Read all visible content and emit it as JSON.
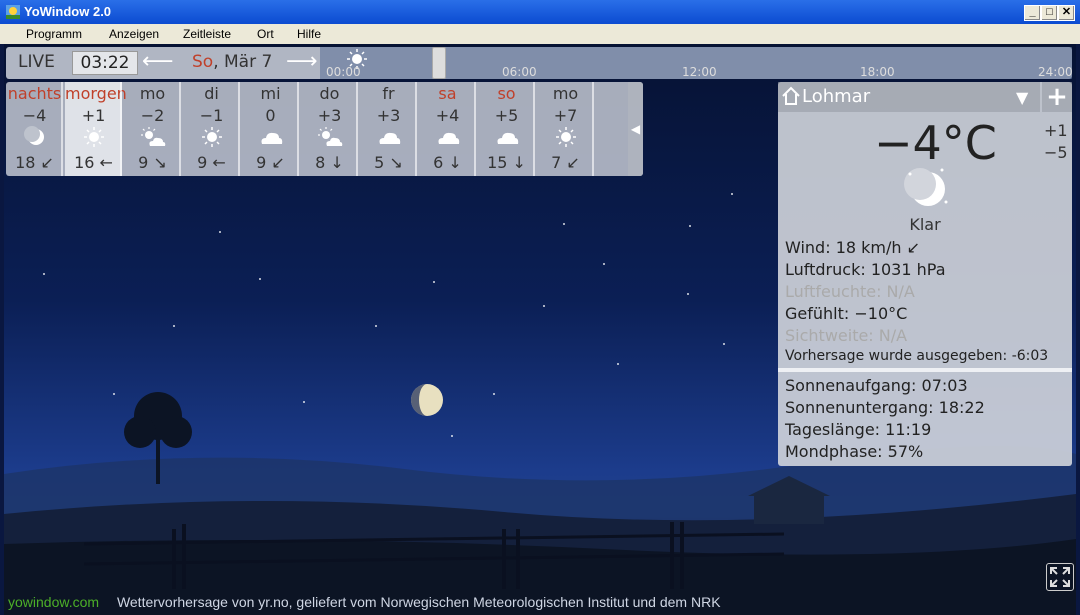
{
  "window": {
    "title": "YoWindow 2.0"
  },
  "menu": [
    "Programm",
    "Anzeigen",
    "Zeitleiste",
    "Ort",
    "Hilfe"
  ],
  "timebar": {
    "live": "LIVE",
    "time": "03:22",
    "date_day": "So",
    "date_rest": ", Mär 7",
    "ticks": [
      "00:00",
      "06:00",
      "12:00",
      "18:00",
      "24:00"
    ]
  },
  "forecast": [
    {
      "name": "nachts",
      "red": true,
      "temp": "−4",
      "icon": "moon-icon",
      "wind": "18 ↙"
    },
    {
      "name": "morgen",
      "red": true,
      "temp": "+1",
      "icon": "sun-icon",
      "wind": "16 ←"
    },
    {
      "name": "mo",
      "red": false,
      "temp": "−2",
      "icon": "sun-cloud-icon",
      "wind": "9 ↘"
    },
    {
      "name": "di",
      "red": false,
      "temp": "−1",
      "icon": "sun-icon",
      "wind": "9 ←"
    },
    {
      "name": "mi",
      "red": false,
      "temp": "0",
      "icon": "cloud-icon",
      "wind": "9 ↙"
    },
    {
      "name": "do",
      "red": false,
      "temp": "+3",
      "icon": "sun-cloud-icon",
      "wind": "8 ↓"
    },
    {
      "name": "fr",
      "red": false,
      "temp": "+3",
      "icon": "cloud-icon",
      "wind": "5 ↘"
    },
    {
      "name": "sa",
      "red": true,
      "temp": "+4",
      "icon": "cloud-icon",
      "wind": "6 ↓"
    },
    {
      "name": "so",
      "red": true,
      "temp": "+5",
      "icon": "cloud-icon",
      "wind": "15 ↓"
    },
    {
      "name": "mo",
      "red": false,
      "temp": "+7",
      "icon": "sun-icon",
      "wind": "7 ↙"
    }
  ],
  "panel": {
    "location": "Lohmar",
    "temp": "−4°C",
    "high": "+1",
    "low": "−5",
    "condition": "Klar",
    "wind": "Wind:  18 km/h ↙",
    "pressure": "Luftdruck:  1031 hPa",
    "humidity": "Luftfeuchte:  N/A",
    "feels": "Gefühlt:  −10°C",
    "visibility": "Sichtweite:  N/A",
    "issued": "Vorhersage wurde ausgegeben:  -6:03",
    "sunrise": "Sonnenaufgang:  07:03",
    "sunset": "Sonnenuntergang:  18:22",
    "daylength": "Tageslänge:  11:19",
    "moonphase": "Mondphase:  57%"
  },
  "footer": {
    "link": "yowindow.com",
    "credit": "Wettervorhersage von yr.no, geliefert vom Norwegischen Meteorologischen Institut und dem NRK"
  }
}
